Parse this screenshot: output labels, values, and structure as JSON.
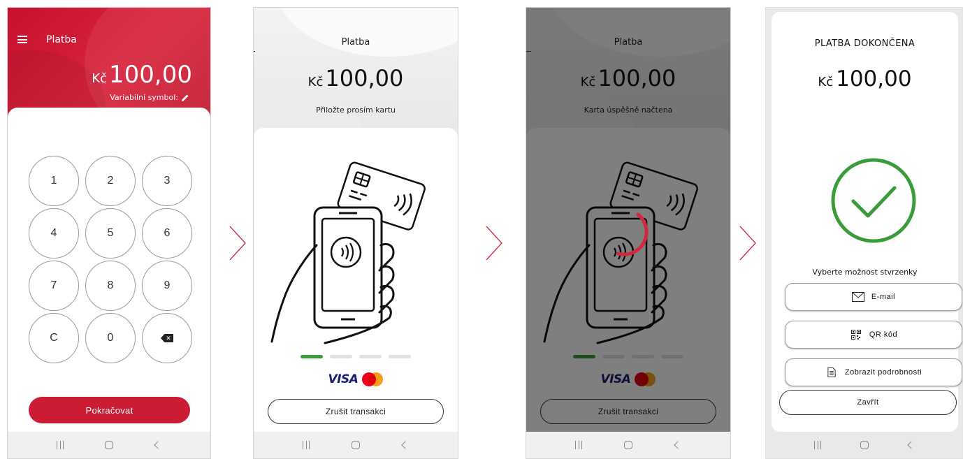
{
  "screen1": {
    "title": "Platba",
    "currency": "Kč",
    "amount": "100,00",
    "variable_symbol_label": "Variabilní symbol:",
    "keys": [
      "1",
      "2",
      "3",
      "4",
      "5",
      "6",
      "7",
      "8",
      "9",
      "C",
      "0"
    ],
    "continue_label": "Pokračovat"
  },
  "screen2": {
    "title": "Platba",
    "currency": "Kč",
    "amount": "100,00",
    "instruction": "Přiložte prosím kartu",
    "cancel_label": "Zrušit transakci",
    "brand_visa": "VISA"
  },
  "screen3": {
    "title": "Platba",
    "currency": "Kč",
    "amount": "100,00",
    "status": "Karta úspěšně načtena",
    "cancel_label": "Zrušit transakci",
    "brand_visa": "VISA"
  },
  "screen4": {
    "title": "PLATBA DOKONČENA",
    "currency": "Kč",
    "amount": "100,00",
    "receipt_prompt": "Vyberte možnost stvrzenky",
    "email_label": "E-mail",
    "qr_label": "QR kód",
    "details_label": "Zobrazit podrobnosti",
    "close_label": "Zavřít"
  },
  "progress": {
    "step": 1,
    "total": 4
  },
  "colors": {
    "brand_red": "#cc1c33",
    "success_green": "#3a9b3a",
    "visa_blue": "#1a1f71"
  },
  "icons": [
    "menu-icon",
    "pencil-icon",
    "backspace-icon",
    "contactless-icon",
    "card-icon",
    "phone-icon",
    "hand-icon",
    "check-icon",
    "mail-icon",
    "qr-icon",
    "document-icon",
    "chevron-right-icon"
  ]
}
